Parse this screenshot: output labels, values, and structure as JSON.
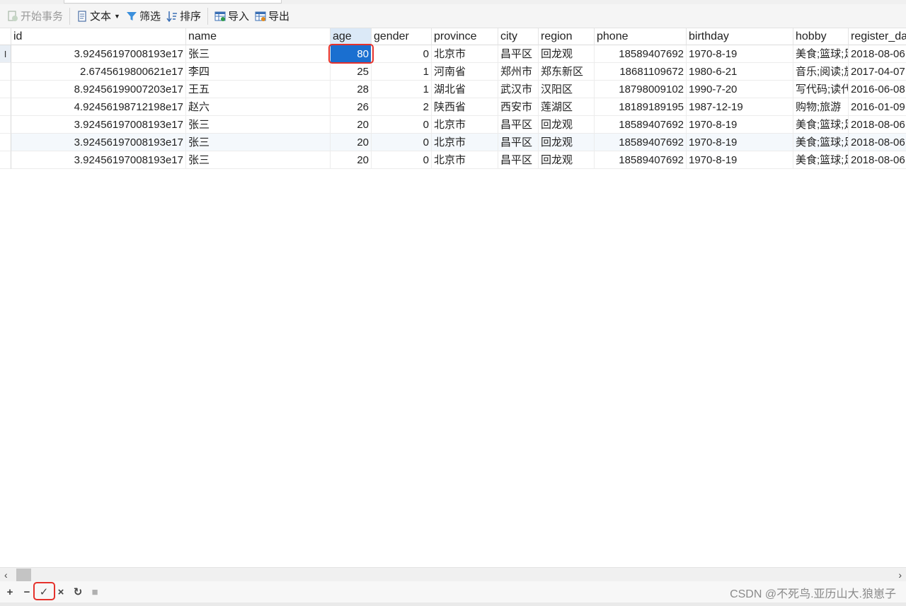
{
  "toolbar": {
    "begin_transaction": "开始事务",
    "text": "文本",
    "filter": "筛选",
    "sort": "排序",
    "import": "导入",
    "export": "导出"
  },
  "columns": [
    "id",
    "name",
    "age",
    "gender",
    "province",
    "city",
    "region",
    "phone",
    "birthday",
    "hobby",
    "register_da"
  ],
  "selected_column": "age",
  "current_row_marker": "I",
  "rows": [
    {
      "id": "3.92456197008193e17",
      "name": "张三",
      "age": "80",
      "gender": "0",
      "province": "北京市",
      "city": "昌平区",
      "region": "回龙观",
      "phone": "18589407692",
      "birthday": "1970-8-19",
      "hobby": "美食;篮球;足",
      "register_date": "2018-08-06"
    },
    {
      "id": "2.6745619800621e17",
      "name": "李四",
      "age": "25",
      "gender": "1",
      "province": "河南省",
      "city": "郑州市",
      "region": "郑东新区",
      "phone": "18681109672",
      "birthday": "1980-6-21",
      "hobby": "音乐;阅读;旅",
      "register_date": "2017-04-07"
    },
    {
      "id": "8.92456199007203e17",
      "name": "王五",
      "age": "28",
      "gender": "1",
      "province": "湖北省",
      "city": "武汉市",
      "region": "汉阳区",
      "phone": "18798009102",
      "birthday": "1990-7-20",
      "hobby": "写代码;读代",
      "register_date": "2016-06-08"
    },
    {
      "id": "4.92456198712198e17",
      "name": "赵六",
      "age": "26",
      "gender": "2",
      "province": "陕西省",
      "city": "西安市",
      "region": "莲湖区",
      "phone": "18189189195",
      "birthday": "1987-12-19",
      "hobby": "购物;旅游",
      "register_date": "2016-01-09"
    },
    {
      "id": "3.92456197008193e17",
      "name": "张三",
      "age": "20",
      "gender": "0",
      "province": "北京市",
      "city": "昌平区",
      "region": "回龙观",
      "phone": "18589407692",
      "birthday": "1970-8-19",
      "hobby": "美食;篮球;足",
      "register_date": "2018-08-06"
    },
    {
      "id": "3.92456197008193e17",
      "name": "张三",
      "age": "20",
      "gender": "0",
      "province": "北京市",
      "city": "昌平区",
      "region": "回龙观",
      "phone": "18589407692",
      "birthday": "1970-8-19",
      "hobby": "美食;篮球;足",
      "register_date": "2018-08-06"
    },
    {
      "id": "3.92456197008193e17",
      "name": "张三",
      "age": "20",
      "gender": "0",
      "province": "北京市",
      "city": "昌平区",
      "region": "回龙观",
      "phone": "18589407692",
      "birthday": "1970-8-19",
      "hobby": "美食;篮球;足",
      "register_date": "2018-08-06"
    }
  ],
  "editing_cell": {
    "row": 0,
    "column": "age"
  },
  "scroll": {
    "left_arrow": "‹",
    "right_arrow": "›"
  },
  "bottombar": {
    "add": "+",
    "delete": "−",
    "apply": "✓",
    "discard": "×",
    "refresh": "↻",
    "stop": "■"
  },
  "watermark": "CSDN @不死鸟.亚历山大.狼崽子",
  "colors": {
    "accent": "#1a6fd0",
    "highlight": "#e5312b",
    "header_selected": "#dbe9f7"
  }
}
